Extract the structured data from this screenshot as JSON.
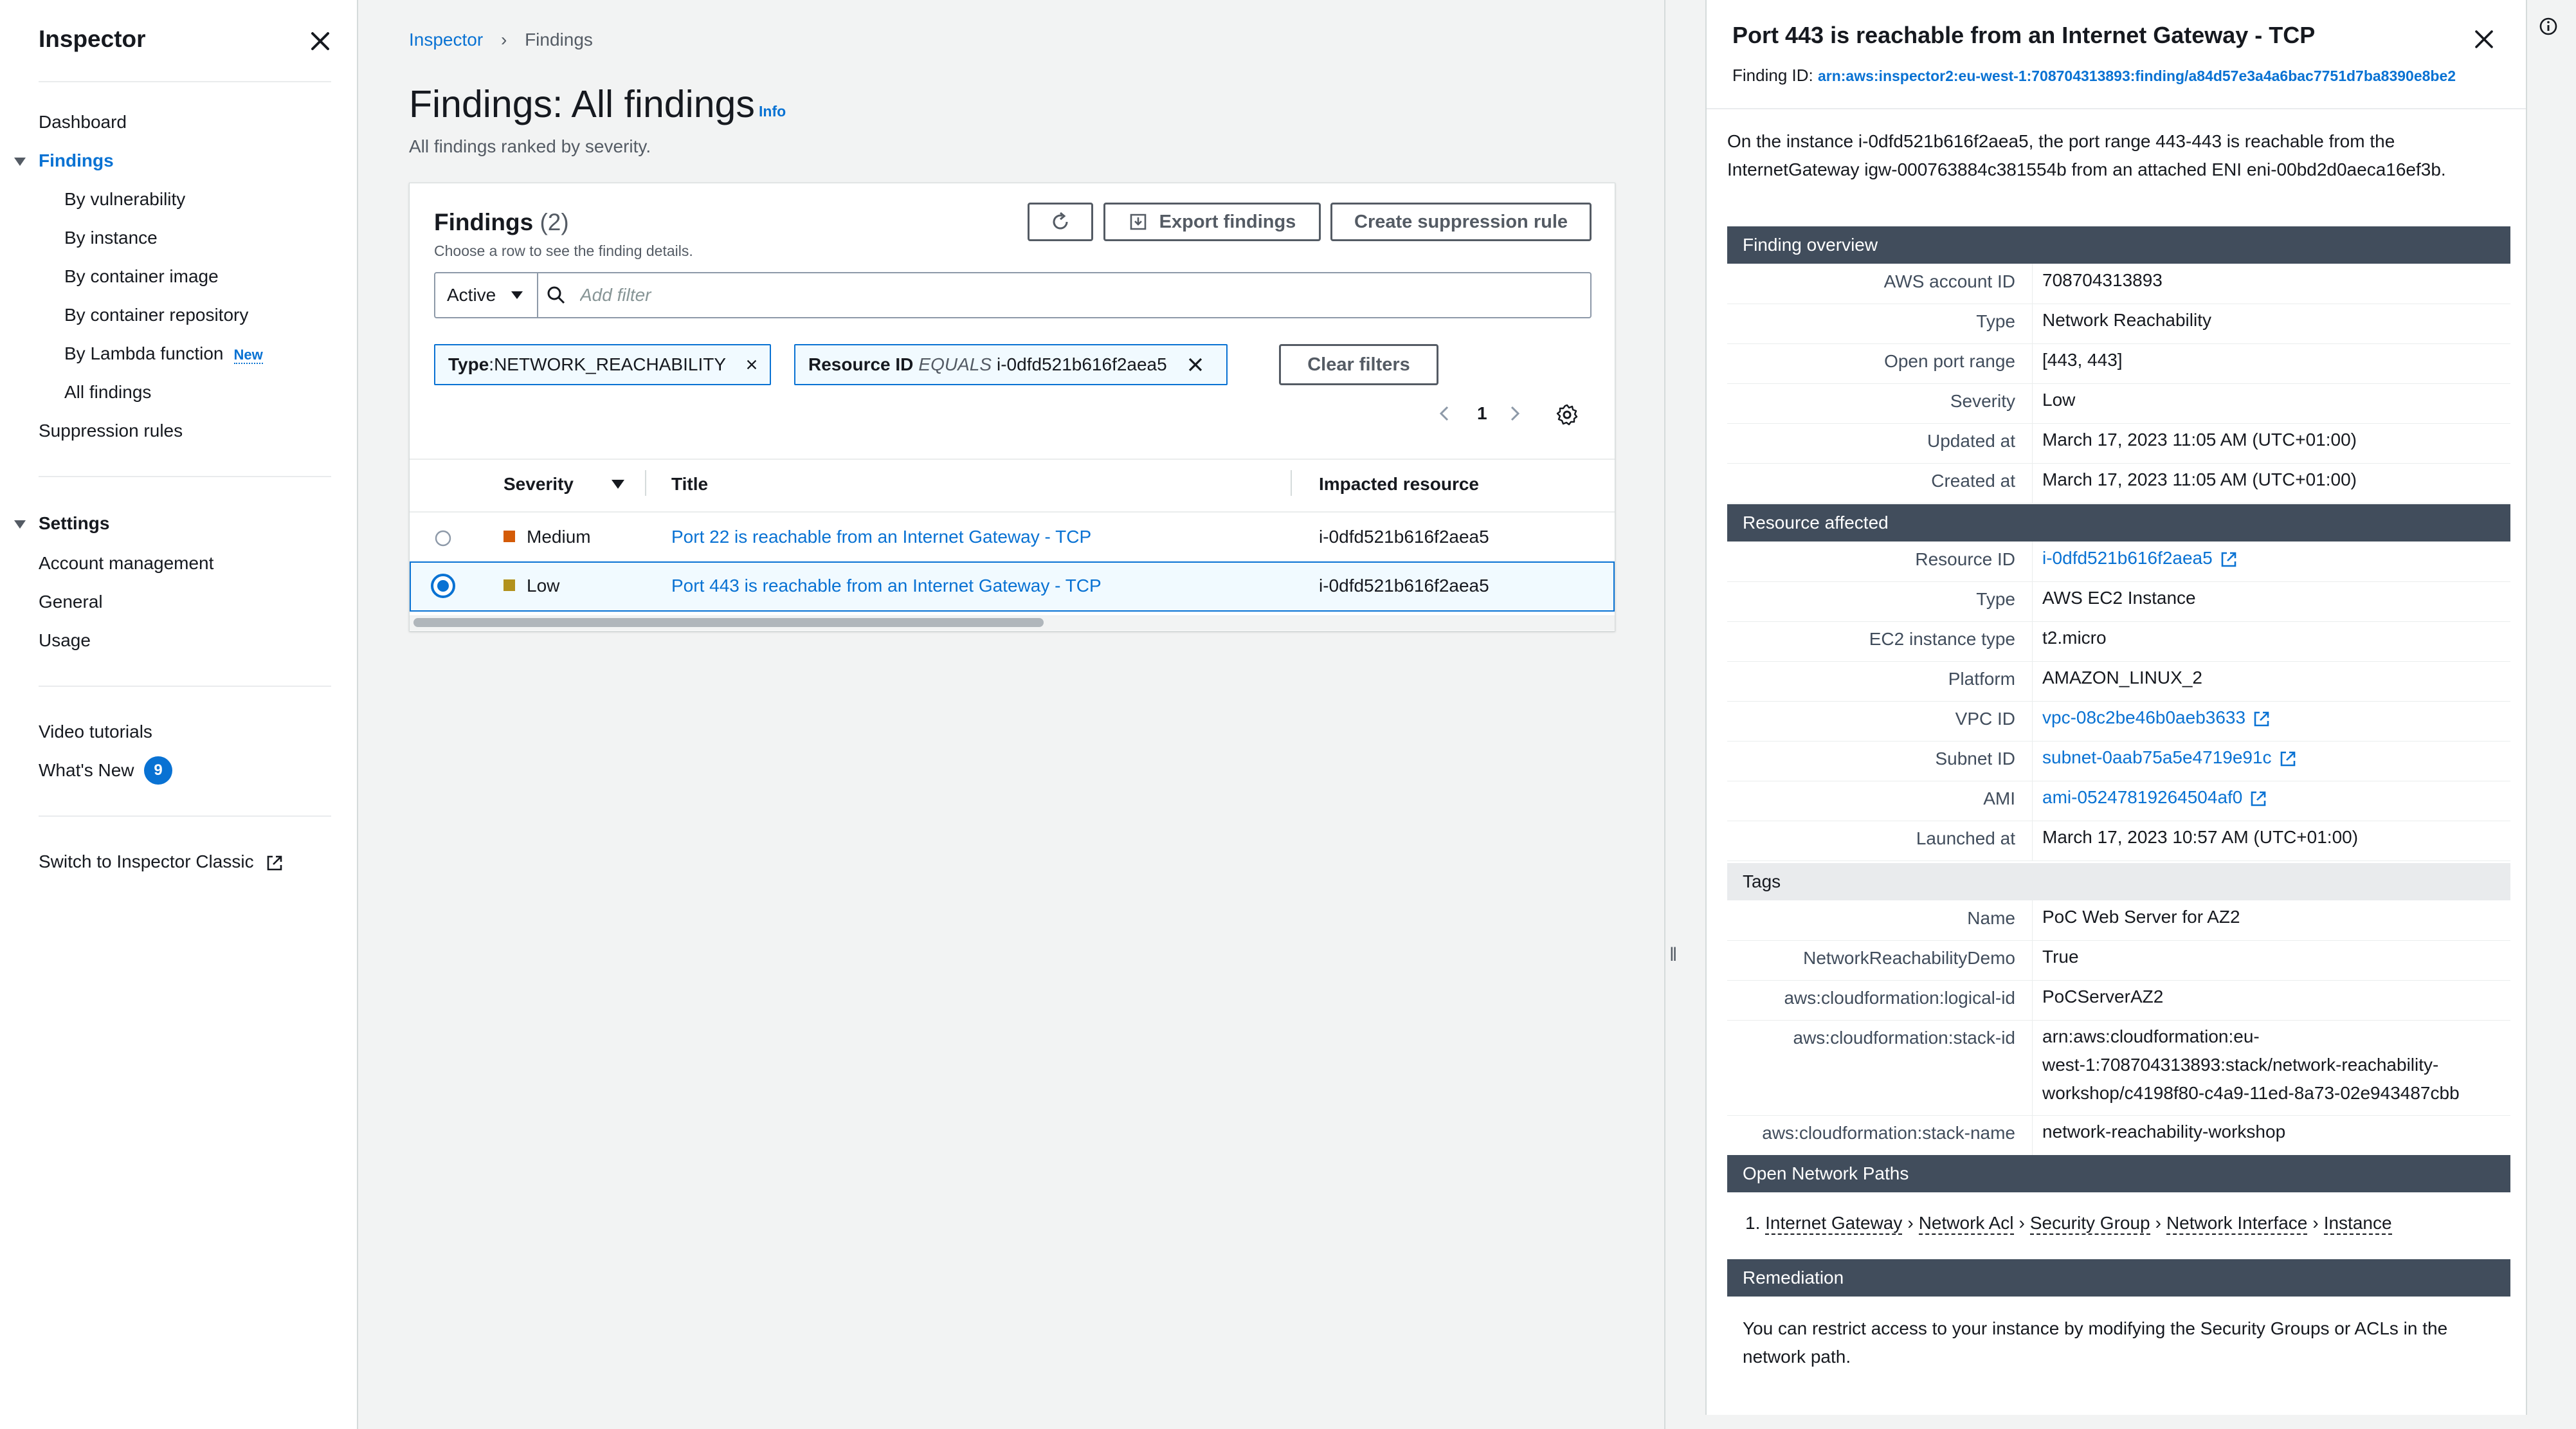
{
  "sidebar": {
    "title": "Inspector",
    "items": [
      {
        "label": "Dashboard"
      },
      {
        "label": "Findings"
      },
      {
        "label": "By vulnerability"
      },
      {
        "label": "By instance"
      },
      {
        "label": "By container image"
      },
      {
        "label": "By container repository"
      },
      {
        "label": "By Lambda function",
        "badge": "New"
      },
      {
        "label": "All findings"
      },
      {
        "label": "Suppression rules"
      }
    ],
    "settings": {
      "label": "Settings",
      "items": [
        {
          "label": "Account management"
        },
        {
          "label": "General"
        },
        {
          "label": "Usage"
        }
      ]
    },
    "video_tutorials": "Video tutorials",
    "whats_new": "What's New",
    "whats_new_count": "9",
    "switch_classic": "Switch to Inspector Classic"
  },
  "breadcrumb": [
    "Inspector",
    "Findings"
  ],
  "page": {
    "title": "Findings: All findings",
    "info": "Info",
    "description": "All findings ranked by severity."
  },
  "findings_panel": {
    "title": "Findings",
    "count": "(2)",
    "subtitle": "Choose a row to see the finding details.",
    "export_label": "Export findings",
    "suppression_label": "Create suppression rule",
    "status_select": "Active",
    "search_placeholder": "Add filter",
    "filters": [
      {
        "key": "Type",
        "sep": ": ",
        "value": "NETWORK_REACHABILITY"
      },
      {
        "key": "Resource ID",
        "op": "EQUALS",
        "value": "i-0dfd521b616f2aea5"
      }
    ],
    "clear_filters": "Clear filters",
    "page_number": "1",
    "columns": {
      "severity": "Severity",
      "title": "Title",
      "resource": "Impacted resource"
    },
    "rows": [
      {
        "severity": "Medium",
        "severity_color": "#d45b07",
        "title": "Port 22 is reachable from an Internet Gateway - TCP",
        "resource": "i-0dfd521b616f2aea5",
        "selected": false
      },
      {
        "severity": "Low",
        "severity_color": "#b2911c",
        "title": "Port 443 is reachable from an Internet Gateway - TCP",
        "resource": "i-0dfd521b616f2aea5",
        "selected": true
      }
    ]
  },
  "detail": {
    "title": "Port 443 is reachable from an Internet Gateway - TCP",
    "finding_id_label": "Finding ID:",
    "finding_id": "arn:aws:inspector2:eu-west-1:708704313893:finding/a84d57e3a4a6bac7751d7ba8390e8be2",
    "description": "On the instance i-0dfd521b616f2aea5, the port range 443-443 is reachable from the InternetGateway igw-000763884c381554b from an attached ENI eni-00bd2d0aeca16ef3b.",
    "overview_header": "Finding overview",
    "overview": [
      {
        "k": "AWS account ID",
        "v": "708704313893"
      },
      {
        "k": "Type",
        "v": "Network Reachability"
      },
      {
        "k": "Open port range",
        "v": "[443, 443]"
      },
      {
        "k": "Severity",
        "v": "Low"
      },
      {
        "k": "Updated at",
        "v": "March 17, 2023 11:05 AM (UTC+01:00)"
      },
      {
        "k": "Created at",
        "v": "March 17, 2023 11:05 AM (UTC+01:00)"
      }
    ],
    "resource_header": "Resource affected",
    "resource": [
      {
        "k": "Resource ID",
        "v": "i-0dfd521b616f2aea5",
        "link": true
      },
      {
        "k": "Type",
        "v": "AWS EC2 Instance"
      },
      {
        "k": "EC2 instance type",
        "v": "t2.micro"
      },
      {
        "k": "Platform",
        "v": "AMAZON_LINUX_2"
      },
      {
        "k": "VPC ID",
        "v": "vpc-08c2be46b0aeb3633",
        "link": true
      },
      {
        "k": "Subnet ID",
        "v": "subnet-0aab75a5e4719e91c",
        "link": true
      },
      {
        "k": "AMI",
        "v": "ami-05247819264504af0",
        "link": true
      },
      {
        "k": "Launched at",
        "v": "March 17, 2023 10:57 AM (UTC+01:00)"
      }
    ],
    "tags_header": "Tags",
    "tags": [
      {
        "k": "Name",
        "v": "PoC Web Server for AZ2"
      },
      {
        "k": "NetworkReachabilityDemo",
        "v": "True"
      },
      {
        "k": "aws:cloudformation:logical-id",
        "v": "PoCServerAZ2"
      },
      {
        "k": "aws:cloudformation:stack-id",
        "v1": "arn:aws:cloudformation:eu-",
        "v2": "west-1:708704313893:stack/network-reachability-",
        "v3": "workshop/c4198f80-c4a9-11ed-8a73-02e943487cbb"
      },
      {
        "k": "aws:cloudformation:stack-name",
        "v": "network-reachability-workshop"
      }
    ],
    "paths_header": "Open Network Paths",
    "paths_prefix": "1.",
    "paths": [
      "Internet Gateway",
      "Network Acl",
      "Security Group",
      "Network Interface",
      "Instance"
    ],
    "remediation_header": "Remediation",
    "remediation": "You can restrict access to your instance by modifying the Security Groups or ACLs in the network path."
  },
  "colors": {
    "link": "#0972d3",
    "header_dark": "#414d5c",
    "selected_bg": "#f1faff"
  }
}
